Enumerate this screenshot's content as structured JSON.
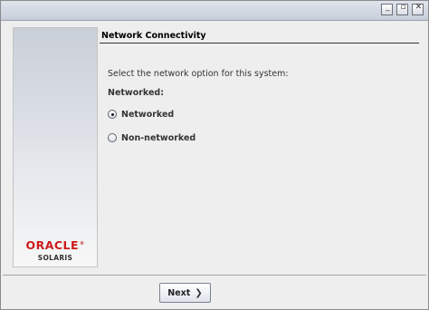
{
  "window": {
    "title_buttons": [
      {
        "name": "minimize",
        "icon": "minimize-icon",
        "glyph": "_"
      },
      {
        "name": "maximize",
        "icon": "maximize-icon",
        "glyph": "▫"
      },
      {
        "name": "close",
        "icon": "close-icon",
        "glyph": "✕"
      }
    ]
  },
  "sidebar": {
    "brand": "ORACLE",
    "trademark": "®",
    "product": "SOLARIS",
    "brand_color": "#cc1a1a"
  },
  "main": {
    "heading": "Network Connectivity",
    "prompt": "Select the network option for this system:",
    "group_label": "Networked:",
    "options": [
      {
        "label": "Networked",
        "selected": true
      },
      {
        "label": "Non-networked",
        "selected": false
      }
    ]
  },
  "footer": {
    "next_label": "Next",
    "next_icon": "chevron-right-double-icon",
    "next_glyph": "❯"
  }
}
